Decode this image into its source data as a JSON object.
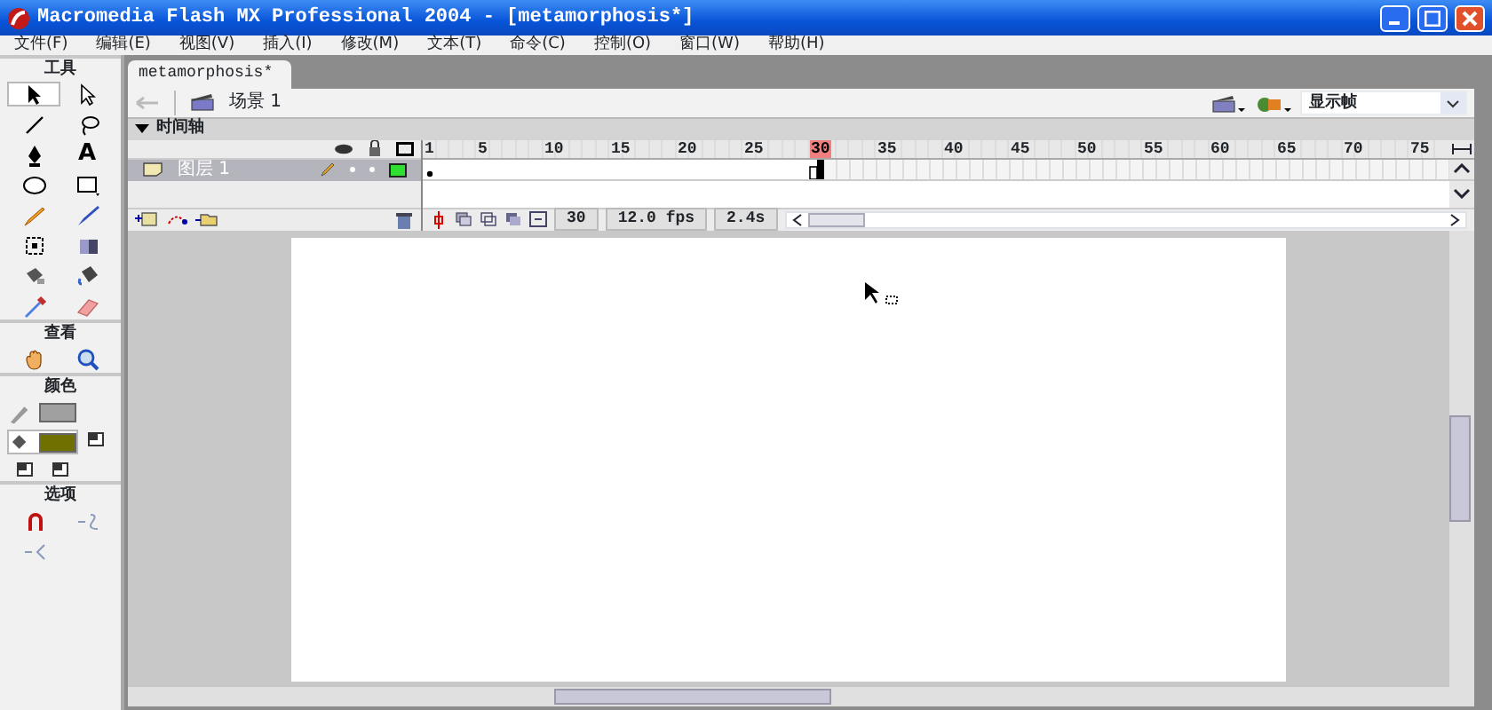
{
  "window": {
    "title": "Macromedia Flash MX Professional 2004 - [metamorphosis*]"
  },
  "menu": [
    "文件(F)",
    "编辑(E)",
    "视图(V)",
    "插入(I)",
    "修改(M)",
    "文本(T)",
    "命令(C)",
    "控制(O)",
    "窗口(W)",
    "帮助(H)"
  ],
  "toolbox": [
    {
      "title": "工具",
      "tools": [
        {
          "kind": "arrow",
          "selected": true
        },
        {
          "kind": "subselect",
          "selected": false
        },
        {
          "kind": "line",
          "selected": false
        },
        {
          "kind": "lasso",
          "selected": false
        },
        {
          "kind": "pen",
          "selected": false
        },
        {
          "kind": "text",
          "text": "A",
          "selected": false
        },
        {
          "kind": "oval",
          "selected": false
        },
        {
          "kind": "rect",
          "selected": false
        },
        {
          "kind": "pencil",
          "selected": false
        },
        {
          "kind": "brush",
          "selected": false
        },
        {
          "kind": "transform",
          "selected": false
        },
        {
          "kind": "fill",
          "selected": false
        },
        {
          "kind": "ink",
          "selected": false
        },
        {
          "kind": "bucket",
          "selected": false
        },
        {
          "kind": "dropper",
          "selected": false
        },
        {
          "kind": "eraser",
          "selected": false
        }
      ]
    },
    {
      "title": "查看",
      "tools": [
        {
          "kind": "hand",
          "selected": false
        },
        {
          "kind": "zoom",
          "selected": false
        }
      ]
    },
    {
      "title": "颜色",
      "tools": [
        {
          "kind": "stroke",
          "color": "#a0a0a0",
          "selected": false
        },
        {
          "kind": "fillcolor",
          "color": "#707000",
          "selected": true
        },
        {
          "kind": "mini",
          "selected": false
        },
        {
          "kind": "mini",
          "selected": false
        },
        {
          "kind": "mini",
          "selected": false
        }
      ]
    },
    {
      "title": "选项",
      "tools": [
        {
          "kind": "magnet",
          "selected": false
        },
        {
          "kind": "smooth",
          "selected": false
        },
        {
          "kind": "straight",
          "selected": false
        }
      ]
    }
  ],
  "document": {
    "tab": "metamorphosis*",
    "scene": "场景 1",
    "view": "显示帧"
  },
  "timeline": {
    "title": "时间轴",
    "layers": [
      {
        "name": "图层 1",
        "selected": true
      }
    ],
    "ruler": [
      {
        "label": "1",
        "selected": false
      },
      {
        "label": "5",
        "selected": false
      },
      {
        "label": "10",
        "selected": false
      },
      {
        "label": "15",
        "selected": false
      },
      {
        "label": "20",
        "selected": false
      },
      {
        "label": "25",
        "selected": false
      },
      {
        "label": "30",
        "selected": true
      },
      {
        "label": "35",
        "selected": false
      },
      {
        "label": "40",
        "selected": false
      },
      {
        "label": "45",
        "selected": false
      },
      {
        "label": "50",
        "selected": false
      },
      {
        "label": "55",
        "selected": false
      },
      {
        "label": "60",
        "selected": false
      },
      {
        "label": "65",
        "selected": false
      },
      {
        "label": "70",
        "selected": false
      },
      {
        "label": "75",
        "selected": false
      }
    ],
    "current_frame": "30",
    "fps": "12.0 fps",
    "elapsed": "2.4s"
  }
}
